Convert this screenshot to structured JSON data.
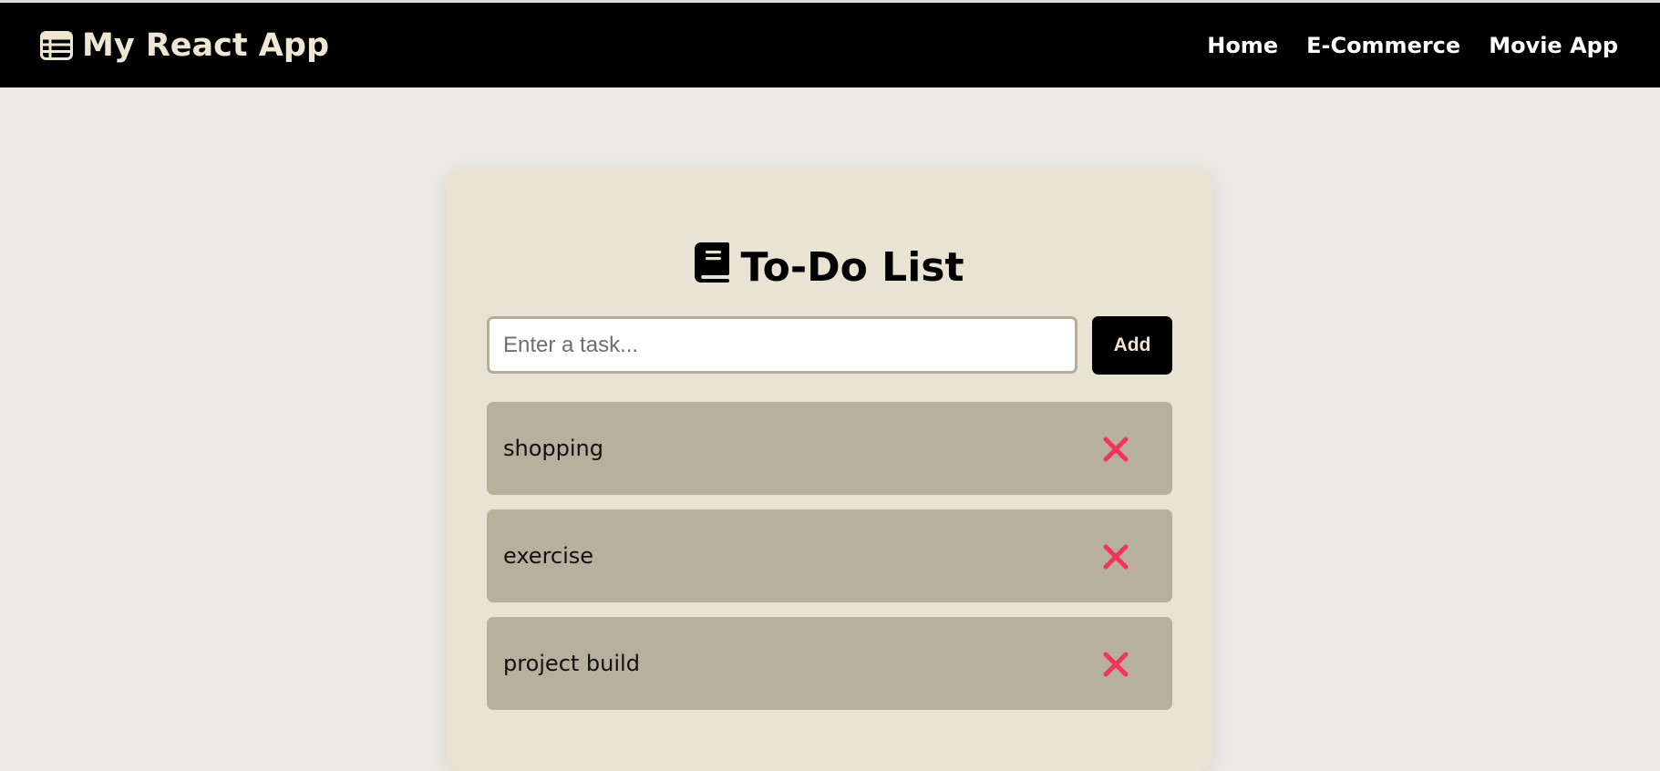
{
  "header": {
    "brand_icon": "table-list-icon",
    "brand_title": "My React App",
    "nav": [
      {
        "label": "Home"
      },
      {
        "label": "E-Commerce"
      },
      {
        "label": "Movie App"
      }
    ]
  },
  "todo": {
    "title_icon": "book-icon",
    "title": "To-Do List",
    "input": {
      "placeholder": "Enter a task...",
      "value": ""
    },
    "add_label": "Add",
    "delete_icon": "close-x-icon",
    "tasks": [
      {
        "label": "shopping"
      },
      {
        "label": "exercise"
      },
      {
        "label": "project build"
      }
    ]
  },
  "colors": {
    "navbar_bg": "#000000",
    "page_bg": "#eae9e4",
    "card_bg": "#e9e3d3",
    "task_bg": "#b7b09d",
    "delete_red": "#f2335b",
    "brand_text": "#efe6d4"
  }
}
